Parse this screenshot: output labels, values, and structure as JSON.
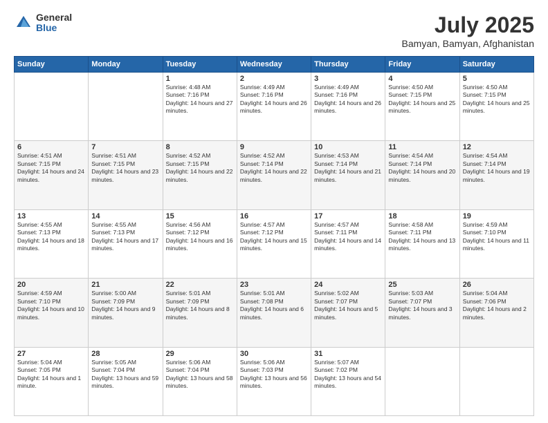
{
  "logo": {
    "general": "General",
    "blue": "Blue"
  },
  "header": {
    "month_year": "July 2025",
    "location": "Bamyan, Bamyan, Afghanistan"
  },
  "weekdays": [
    "Sunday",
    "Monday",
    "Tuesday",
    "Wednesday",
    "Thursday",
    "Friday",
    "Saturday"
  ],
  "weeks": [
    [
      {
        "day": "",
        "info": ""
      },
      {
        "day": "",
        "info": ""
      },
      {
        "day": "1",
        "info": "Sunrise: 4:48 AM\nSunset: 7:16 PM\nDaylight: 14 hours and 27 minutes."
      },
      {
        "day": "2",
        "info": "Sunrise: 4:49 AM\nSunset: 7:16 PM\nDaylight: 14 hours and 26 minutes."
      },
      {
        "day": "3",
        "info": "Sunrise: 4:49 AM\nSunset: 7:16 PM\nDaylight: 14 hours and 26 minutes."
      },
      {
        "day": "4",
        "info": "Sunrise: 4:50 AM\nSunset: 7:15 PM\nDaylight: 14 hours and 25 minutes."
      },
      {
        "day": "5",
        "info": "Sunrise: 4:50 AM\nSunset: 7:15 PM\nDaylight: 14 hours and 25 minutes."
      }
    ],
    [
      {
        "day": "6",
        "info": "Sunrise: 4:51 AM\nSunset: 7:15 PM\nDaylight: 14 hours and 24 minutes."
      },
      {
        "day": "7",
        "info": "Sunrise: 4:51 AM\nSunset: 7:15 PM\nDaylight: 14 hours and 23 minutes."
      },
      {
        "day": "8",
        "info": "Sunrise: 4:52 AM\nSunset: 7:15 PM\nDaylight: 14 hours and 22 minutes."
      },
      {
        "day": "9",
        "info": "Sunrise: 4:52 AM\nSunset: 7:14 PM\nDaylight: 14 hours and 22 minutes."
      },
      {
        "day": "10",
        "info": "Sunrise: 4:53 AM\nSunset: 7:14 PM\nDaylight: 14 hours and 21 minutes."
      },
      {
        "day": "11",
        "info": "Sunrise: 4:54 AM\nSunset: 7:14 PM\nDaylight: 14 hours and 20 minutes."
      },
      {
        "day": "12",
        "info": "Sunrise: 4:54 AM\nSunset: 7:14 PM\nDaylight: 14 hours and 19 minutes."
      }
    ],
    [
      {
        "day": "13",
        "info": "Sunrise: 4:55 AM\nSunset: 7:13 PM\nDaylight: 14 hours and 18 minutes."
      },
      {
        "day": "14",
        "info": "Sunrise: 4:55 AM\nSunset: 7:13 PM\nDaylight: 14 hours and 17 minutes."
      },
      {
        "day": "15",
        "info": "Sunrise: 4:56 AM\nSunset: 7:12 PM\nDaylight: 14 hours and 16 minutes."
      },
      {
        "day": "16",
        "info": "Sunrise: 4:57 AM\nSunset: 7:12 PM\nDaylight: 14 hours and 15 minutes."
      },
      {
        "day": "17",
        "info": "Sunrise: 4:57 AM\nSunset: 7:11 PM\nDaylight: 14 hours and 14 minutes."
      },
      {
        "day": "18",
        "info": "Sunrise: 4:58 AM\nSunset: 7:11 PM\nDaylight: 14 hours and 13 minutes."
      },
      {
        "day": "19",
        "info": "Sunrise: 4:59 AM\nSunset: 7:10 PM\nDaylight: 14 hours and 11 minutes."
      }
    ],
    [
      {
        "day": "20",
        "info": "Sunrise: 4:59 AM\nSunset: 7:10 PM\nDaylight: 14 hours and 10 minutes."
      },
      {
        "day": "21",
        "info": "Sunrise: 5:00 AM\nSunset: 7:09 PM\nDaylight: 14 hours and 9 minutes."
      },
      {
        "day": "22",
        "info": "Sunrise: 5:01 AM\nSunset: 7:09 PM\nDaylight: 14 hours and 8 minutes."
      },
      {
        "day": "23",
        "info": "Sunrise: 5:01 AM\nSunset: 7:08 PM\nDaylight: 14 hours and 6 minutes."
      },
      {
        "day": "24",
        "info": "Sunrise: 5:02 AM\nSunset: 7:07 PM\nDaylight: 14 hours and 5 minutes."
      },
      {
        "day": "25",
        "info": "Sunrise: 5:03 AM\nSunset: 7:07 PM\nDaylight: 14 hours and 3 minutes."
      },
      {
        "day": "26",
        "info": "Sunrise: 5:04 AM\nSunset: 7:06 PM\nDaylight: 14 hours and 2 minutes."
      }
    ],
    [
      {
        "day": "27",
        "info": "Sunrise: 5:04 AM\nSunset: 7:05 PM\nDaylight: 14 hours and 1 minute."
      },
      {
        "day": "28",
        "info": "Sunrise: 5:05 AM\nSunset: 7:04 PM\nDaylight: 13 hours and 59 minutes."
      },
      {
        "day": "29",
        "info": "Sunrise: 5:06 AM\nSunset: 7:04 PM\nDaylight: 13 hours and 58 minutes."
      },
      {
        "day": "30",
        "info": "Sunrise: 5:06 AM\nSunset: 7:03 PM\nDaylight: 13 hours and 56 minutes."
      },
      {
        "day": "31",
        "info": "Sunrise: 5:07 AM\nSunset: 7:02 PM\nDaylight: 13 hours and 54 minutes."
      },
      {
        "day": "",
        "info": ""
      },
      {
        "day": "",
        "info": ""
      }
    ]
  ]
}
